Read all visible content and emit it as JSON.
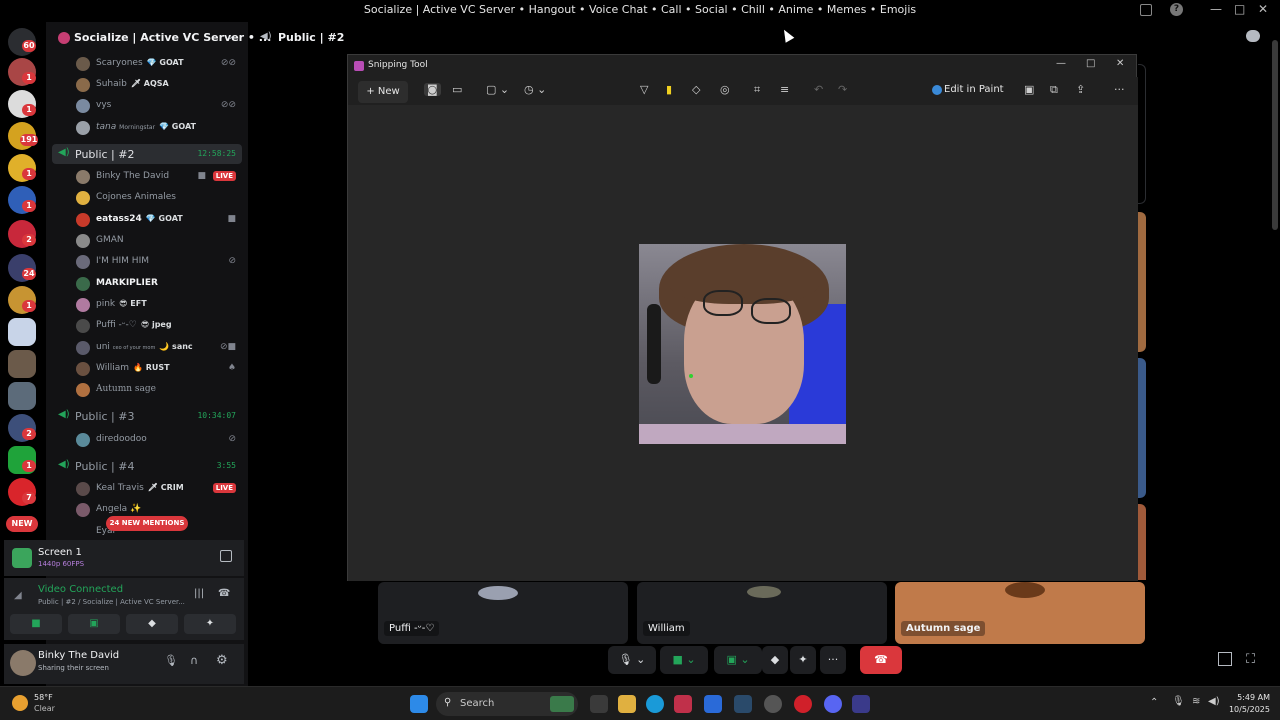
{
  "window": {
    "title": "Socialize | Active VC Server • Hangout • Voice Chat • Call • Social • Chill • Anime • Memes • Emojis"
  },
  "rail": {
    "badges": [
      "60",
      "1",
      "1",
      "191",
      "1",
      "1",
      "2",
      "24",
      "1",
      "2",
      "1",
      "7"
    ],
    "new_label": "NEW"
  },
  "sidebar": {
    "server_name": "Socialize | Active VC Server • ...",
    "top_users": [
      {
        "name": "Scaryones",
        "tag": "💎 GOAT"
      },
      {
        "name": "Suhaib",
        "tag": "🗡 AQSA"
      },
      {
        "name": "vys",
        "tag": ""
      },
      {
        "name": "tana",
        "tag": "💎 GOAT",
        "sub": "Morningstar"
      }
    ],
    "channels": [
      {
        "name": "Public | #2",
        "time": "12:58:25",
        "users": [
          {
            "name": "Binky The David",
            "live": "LIVE"
          },
          {
            "name": "Cojones Animales"
          },
          {
            "name": "eatass24",
            "tag": "💎 GOAT",
            "bold": true
          },
          {
            "name": "GMAN"
          },
          {
            "name": "I'M HIM HIM"
          },
          {
            "name": "MARKIPLIER",
            "bold": true
          },
          {
            "name": "pink",
            "tag": "😎 EFT"
          },
          {
            "name": "Puffi -ᵕ-♡",
            "tag": "😎 jpeg"
          },
          {
            "name": "uni",
            "tag": "🌙 sanc",
            "sub": "ceo of your mom"
          },
          {
            "name": "William",
            "tag": "🔥 RUST"
          },
          {
            "name": "Autumn sage"
          }
        ]
      },
      {
        "name": "Public | #3",
        "time": "10:34:07",
        "users": [
          {
            "name": "diredoodoo"
          }
        ]
      },
      {
        "name": "Public | #4",
        "time": "3:55",
        "users": [
          {
            "name": "Keal Travis",
            "tag": "🗡 CRIM",
            "live": "LIVE"
          },
          {
            "name": "Angela ✨"
          },
          {
            "name": "Eyal"
          }
        ]
      }
    ],
    "mentions_label": "24 NEW MENTIONS"
  },
  "stream_panel": {
    "title": "Screen 1",
    "quality": "1440p 60FPS"
  },
  "voice_panel": {
    "status": "Video Connected",
    "channel": "Public | #2 / Socialize | Active VC Server..."
  },
  "user_panel": {
    "name": "Binky The David",
    "status": "Sharing their screen"
  },
  "stage": {
    "title": "Public | #2",
    "tiles": [
      {
        "label": "Puffi -ᵕ-♡"
      },
      {
        "label": "William"
      },
      {
        "label": "Autumn sage"
      }
    ]
  },
  "snipping_tool": {
    "title": "Snipping Tool",
    "new_label": "New",
    "edit_in_paint": "Edit in Paint"
  },
  "taskbar": {
    "weather_temp": "58°F",
    "weather_desc": "Clear",
    "search_placeholder": "Search",
    "time": "5:49 AM",
    "date": "10/5/2025"
  },
  "colors": {
    "accent_green": "#23a55a",
    "live_red": "#da373c",
    "hangup_red": "#da373c"
  }
}
